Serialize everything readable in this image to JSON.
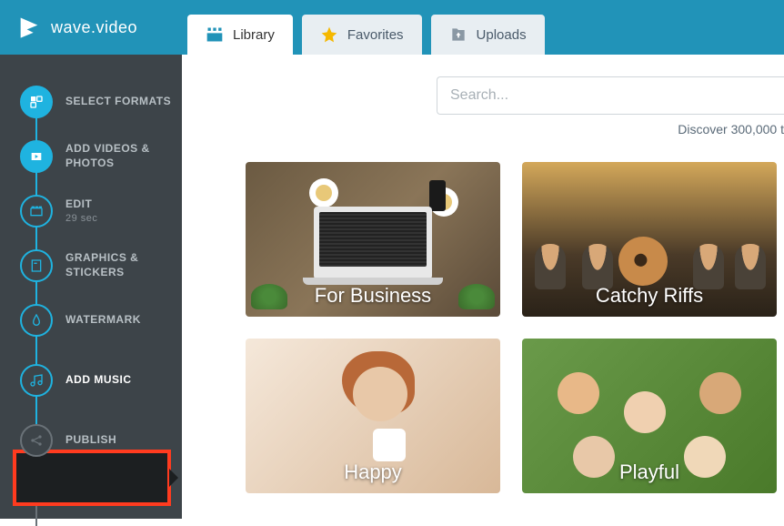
{
  "brand": {
    "name_light": "wave",
    "name_bold": ".video"
  },
  "tabs": {
    "library": "Library",
    "favorites": "Favorites",
    "uploads": "Uploads"
  },
  "sidebar": {
    "steps": [
      {
        "label": "SELECT FORMATS"
      },
      {
        "label": "ADD VIDEOS & PHOTOS"
      },
      {
        "label": "EDIT",
        "sub": "29 sec"
      },
      {
        "label": "GRAPHICS & STICKERS"
      },
      {
        "label": "WATERMARK"
      },
      {
        "label": "ADD MUSIC"
      },
      {
        "label": "PUBLISH"
      }
    ]
  },
  "search": {
    "placeholder": "Search..."
  },
  "discover_text": "Discover 300,000 t",
  "cards": {
    "business": "For Business",
    "riffs": "Catchy Riffs",
    "happy": "Happy",
    "playful": "Playful"
  },
  "colors": {
    "accent": "#1fb3e0",
    "header": "#2193b8",
    "highlight": "#ff3b1f"
  }
}
